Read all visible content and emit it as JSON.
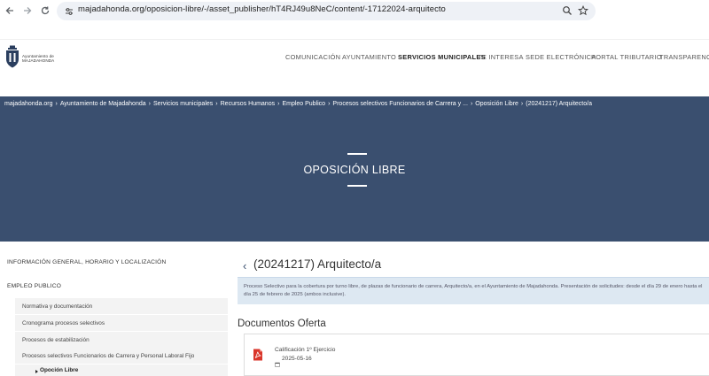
{
  "browser": {
    "back_icon": "arrow-left-icon",
    "forward_icon": "arrow-right-icon",
    "reload_icon": "reload-icon",
    "url": "majadahonda.org/oposicion-libre/-/asset_publisher/hT4RJ49u8NeC/content/-17122024-arquitecto",
    "zoom_icon": "zoom-icon",
    "bookmark_icon": "star-icon"
  },
  "header": {
    "logo_line1": "Ayuntamiento de",
    "logo_line2": "MAJADAHONDA",
    "nav": [
      {
        "label": "COMUNICACIÓN"
      },
      {
        "label": "AYUNTAMIENTO"
      },
      {
        "label": "SERVICIOS MUNICIPALES"
      },
      {
        "label": "TE INTERESA"
      },
      {
        "label": "SEDE ELECTRÓNICA"
      },
      {
        "label": "PORTAL TRIBUTARIO"
      },
      {
        "label": "TRANSPARENCIA"
      }
    ],
    "active_nav": "SERVICIOS MUNICIPALES"
  },
  "breadcrumb": [
    "majadahonda.org",
    "Ayuntamiento de Majadahonda",
    "Servicios municipales",
    "Recursos Humanos",
    "Empleo Publico",
    "Procesos selectivos Funcionarios de Carrera y ...",
    "Oposición Libre",
    "(20241217) Arquitecto/a"
  ],
  "breadcrumb_separator": "›",
  "hero": {
    "title": "OPOSICIÓN LIBRE"
  },
  "sidebar": {
    "top_links": [
      "INFORMACIÓN GENERAL, HORARIO Y LOCALIZACIÓN",
      "EMPLEO PUBLICO"
    ],
    "sub_items": [
      "Normativa y documentación",
      "Cronograma procesos selectivos",
      "Procesos de estabilización",
      "Procesos selectivos Funcionarios de Carrera y Personal Laboral Fijo"
    ],
    "active_item": "Opoción Libre"
  },
  "content": {
    "back_symbol": "‹",
    "title": "(20241217) Arquitecto/a",
    "description": "Proceso Selectivo para la cobertura por turno libre, de plazas de funcionario de carrera, Arquitecto/a, en el Ayuntamiento de Majadahonda. Presentación de solicitudes: desde el día 29 de enero hasta el día 25 de febrero de 2025 (ambos inclusive).",
    "docs_heading": "Documentos Oferta",
    "documents": [
      {
        "name": "Calificación 1º Ejercicio",
        "date": "2025-05-16",
        "icon": "pdf-icon"
      }
    ]
  },
  "colors": {
    "hero_bg": "#3a4f6f",
    "info_bg": "#dde8f2",
    "pdf_red": "#d9362b"
  }
}
